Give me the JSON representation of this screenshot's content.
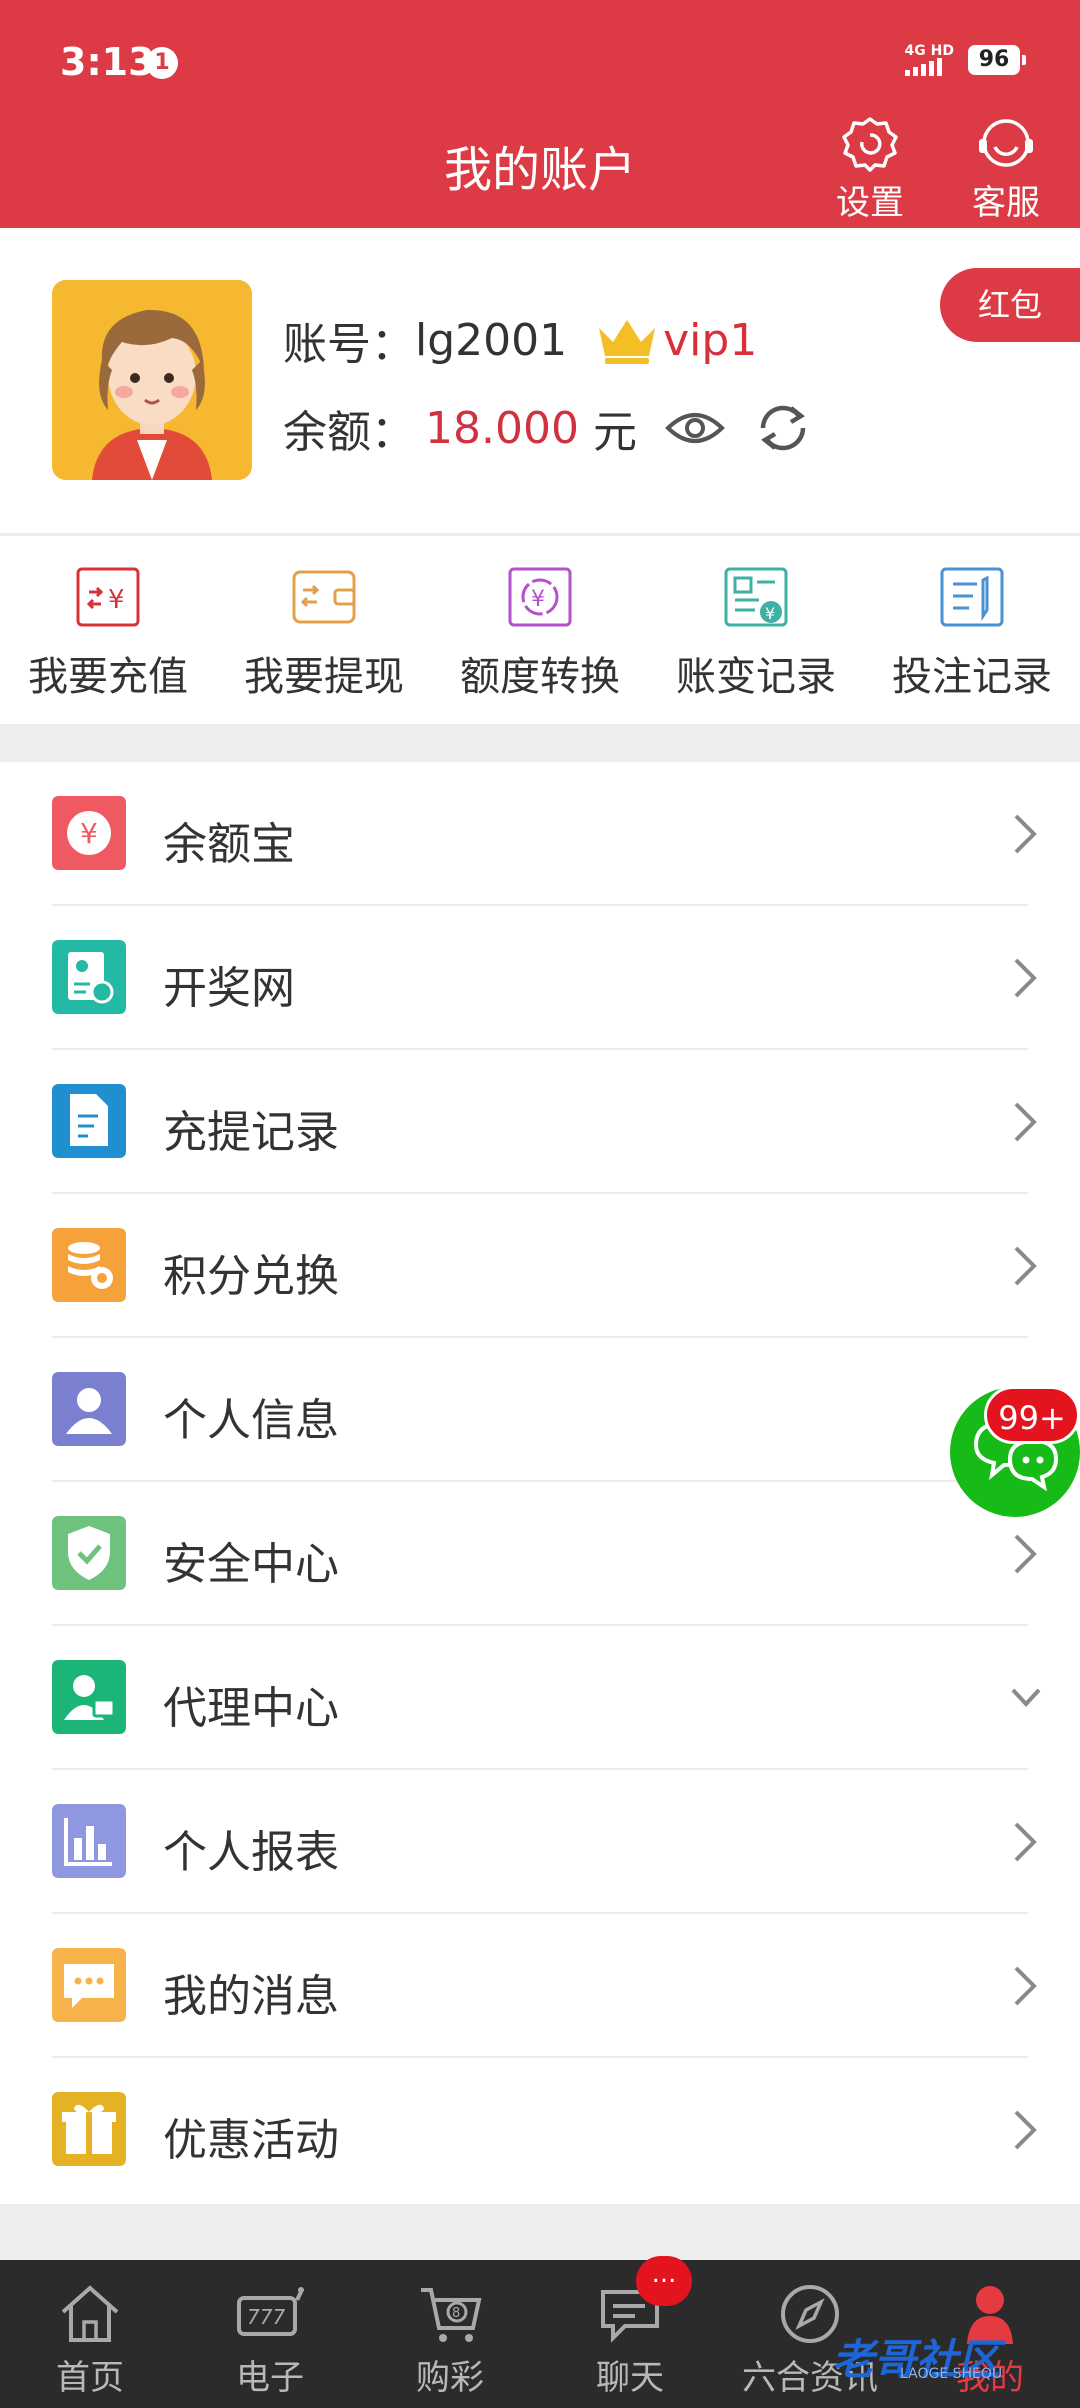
{
  "status_bar": {
    "time": "3:13",
    "notification_count": "1",
    "network": "4G HD",
    "battery": "96"
  },
  "header": {
    "title": "我的账户",
    "settings_label": "设置",
    "service_label": "客服"
  },
  "profile": {
    "account_label": "账号：",
    "account": "lg2001",
    "vip": "vip1",
    "balance_label": "余额：",
    "balance": "18.000",
    "balance_unit": "元",
    "hongbao_label": "红包"
  },
  "quick_actions": [
    {
      "label": "我要充值",
      "icon": "recharge-icon"
    },
    {
      "label": "我要提现",
      "icon": "withdraw-icon"
    },
    {
      "label": "额度转换",
      "icon": "transfer-icon"
    },
    {
      "label": "账变记录",
      "icon": "account-record-icon"
    },
    {
      "label": "投注记录",
      "icon": "bet-record-icon"
    }
  ],
  "menu": [
    {
      "label": "余额宝",
      "icon": "yuebao-icon",
      "color": "#ef5a62"
    },
    {
      "label": "开奖网",
      "icon": "lottery-site-icon",
      "color": "#23b9a4"
    },
    {
      "label": "充提记录",
      "icon": "deposit-record-icon",
      "color": "#1f8fcf"
    },
    {
      "label": "积分兑换",
      "icon": "points-icon",
      "color": "#f5a23a"
    },
    {
      "label": "个人信息",
      "icon": "user-icon",
      "color": "#7b7fd0"
    },
    {
      "label": "安全中心",
      "icon": "shield-icon",
      "color": "#6fc27e"
    },
    {
      "label": "代理中心",
      "icon": "agent-icon",
      "color": "#1bb578"
    },
    {
      "label": "个人报表",
      "icon": "report-icon",
      "color": "#8e97e0"
    },
    {
      "label": "我的消息",
      "icon": "message-icon",
      "color": "#f8b24a"
    },
    {
      "label": "优惠活动",
      "icon": "gift-icon",
      "color": "#e4b224"
    }
  ],
  "float_chat": {
    "badge": "99+"
  },
  "tabs": [
    {
      "label": "首页",
      "icon": "home-icon"
    },
    {
      "label": "电子",
      "icon": "slot-icon"
    },
    {
      "label": "购彩",
      "icon": "cart-icon"
    },
    {
      "label": "聊天",
      "icon": "chat-icon",
      "badge": "..."
    },
    {
      "label": "六合资讯",
      "icon": "compass-icon"
    },
    {
      "label": "我的",
      "icon": "profile-icon",
      "active": true
    }
  ],
  "watermark": "老哥社区",
  "watermark_sub": "LAOGE SHEQU"
}
